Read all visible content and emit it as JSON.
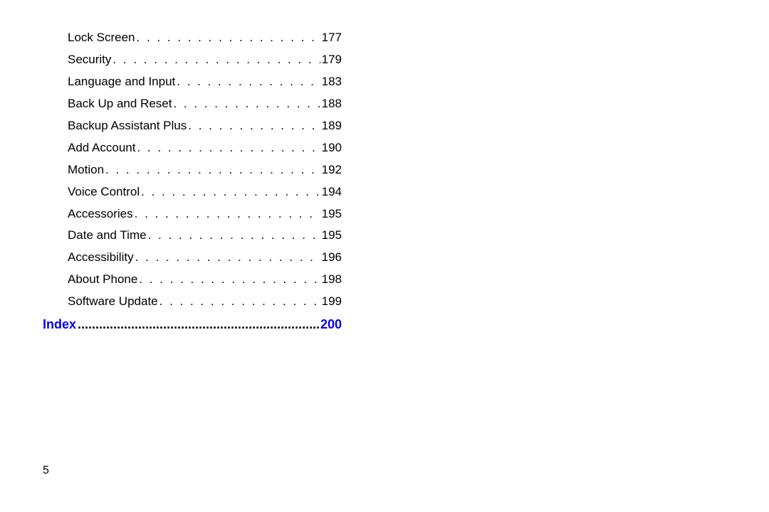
{
  "toc": {
    "entries": [
      {
        "title": "Lock Screen ",
        "page": "177",
        "style": "normal"
      },
      {
        "title": "Security",
        "page": "179",
        "style": "normal"
      },
      {
        "title": "Language and Input",
        "page": "183",
        "style": "normal"
      },
      {
        "title": "Back Up and Reset ",
        "page": "188",
        "style": "normal"
      },
      {
        "title": "Backup Assistant Plus ",
        "page": "189",
        "style": "normal"
      },
      {
        "title": "Add Account ",
        "page": "190",
        "style": "normal"
      },
      {
        "title": "Motion",
        "page": "192",
        "style": "normal"
      },
      {
        "title": "Voice Control",
        "page": "194",
        "style": "normal"
      },
      {
        "title": "Accessories",
        "page": "195",
        "style": "normal"
      },
      {
        "title": "Date and Time",
        "page": "195",
        "style": "normal"
      },
      {
        "title": "Accessibility ",
        "page": "196",
        "style": "normal"
      },
      {
        "title": "About Phone ",
        "page": "198",
        "style": "normal"
      },
      {
        "title": "Software Update ",
        "page": "199",
        "style": "normal"
      },
      {
        "title": "Index ",
        "page": "200",
        "style": "index"
      }
    ]
  },
  "page_number": "5"
}
